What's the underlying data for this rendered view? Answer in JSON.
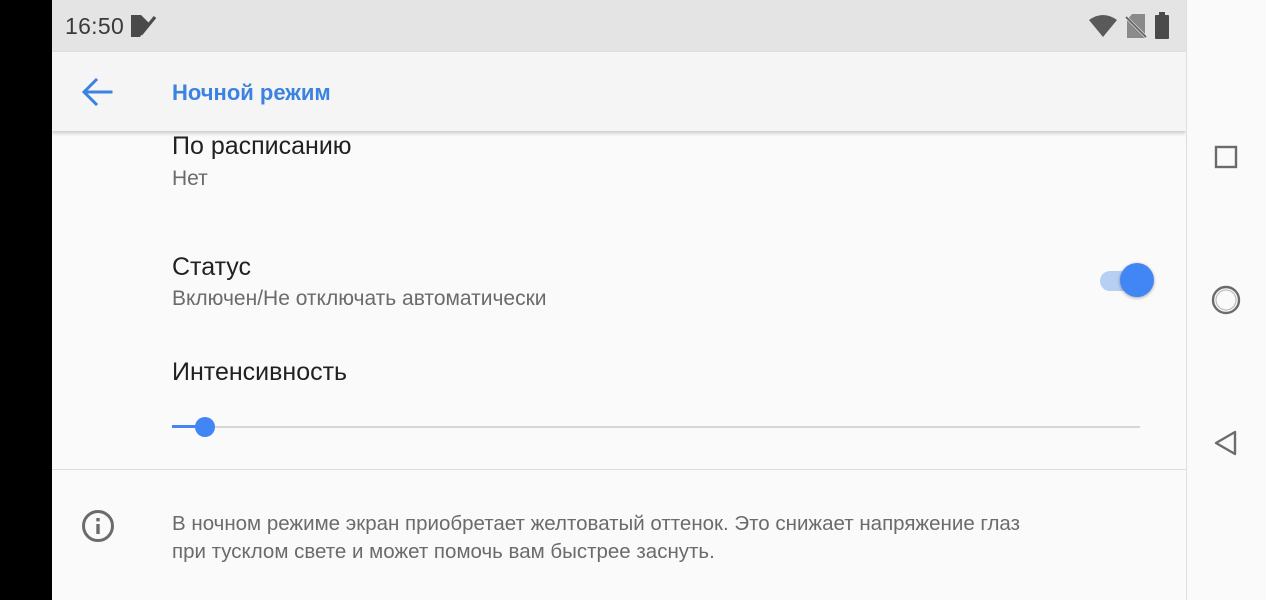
{
  "status_bar": {
    "time": "16:50",
    "icons": [
      "notification-icon",
      "wifi-icon",
      "no-sim-icon",
      "battery-icon"
    ]
  },
  "app_bar": {
    "title": "Ночной режим",
    "back_icon": "arrow-back-icon"
  },
  "preferences": {
    "schedule": {
      "title": "По расписанию",
      "summary": "Нет"
    },
    "status": {
      "title": "Статус",
      "summary": "Включен/Не отключать автоматически",
      "enabled": true
    },
    "intensity": {
      "title": "Интенсивность",
      "value_fraction": 0.034
    }
  },
  "footer": {
    "icon": "info-icon",
    "line1": "В ночном режиме экран приобретает желтоватый оттенок. Это снижает напряжение глаз",
    "line2": "при тусклом свете и может помочь вам быстрее заснуть."
  },
  "nav_bar": {
    "buttons": [
      "recents-icon",
      "home-icon",
      "back-icon"
    ]
  },
  "colors": {
    "accent": "#4285f4",
    "title_accent": "#3c82e1",
    "track_on": "#b7cff3",
    "background": "#fafafa",
    "status_bar": "#e4e4e4"
  }
}
